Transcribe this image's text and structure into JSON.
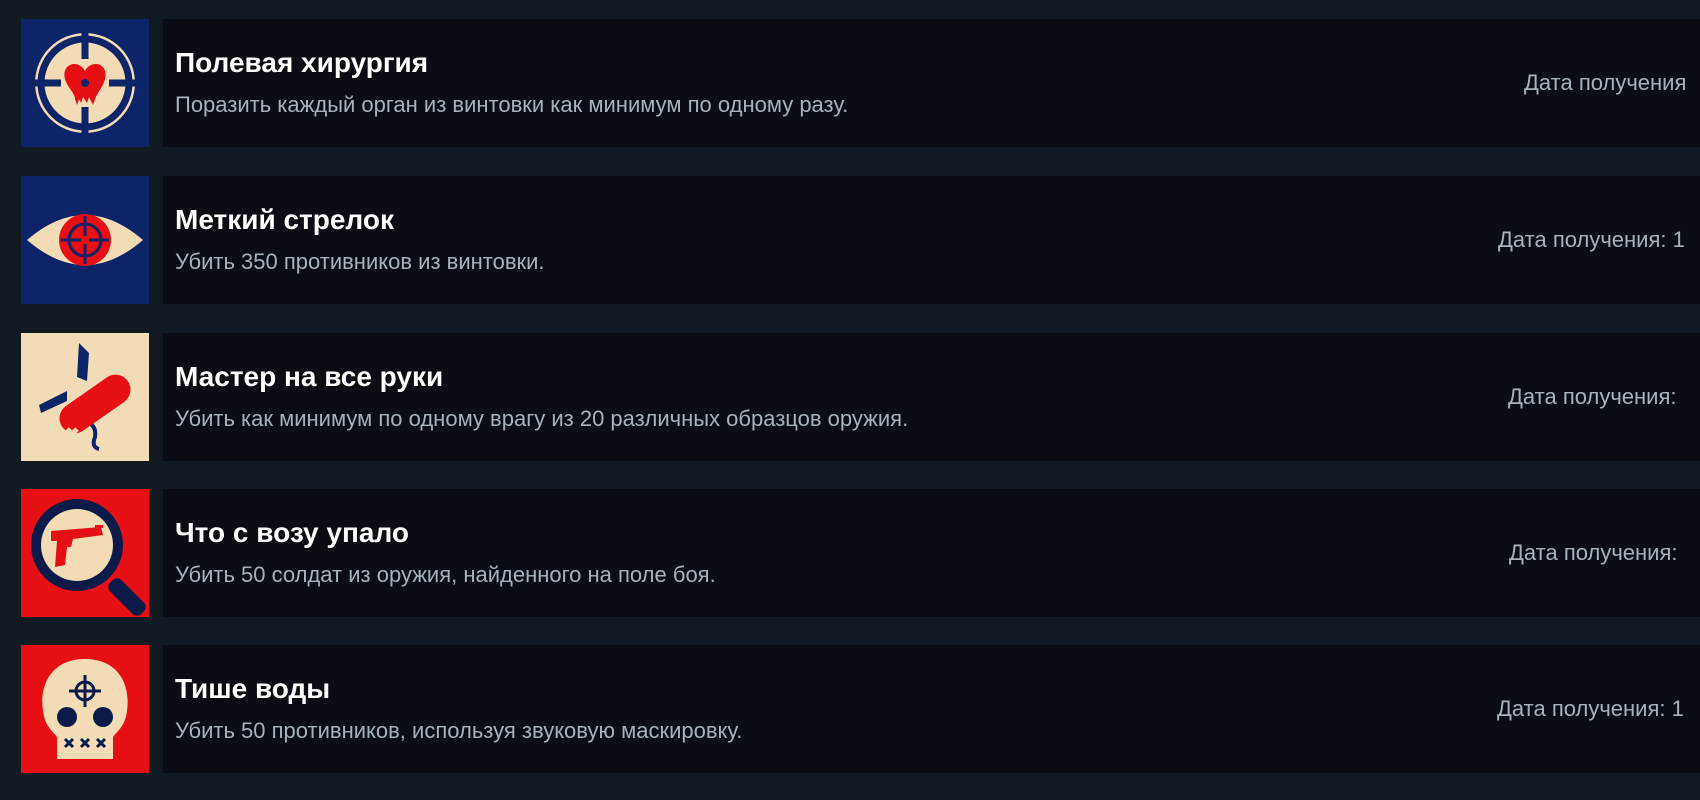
{
  "colors": {
    "page_bg": "#111a23",
    "panel_bg": "#0a0e14",
    "title": "#ffffff",
    "desc": "#a7b2bc",
    "icon_navy": "#0d2468",
    "icon_red": "#e50f14",
    "icon_cream": "#f1dcb6",
    "icon_dark_navy": "#0c1a4a"
  },
  "achievements": [
    {
      "icon": "crosshair-heart-icon",
      "title": "Полевая хирургия",
      "description": "Поразить каждый орган из винтовки как минимум по одному разу.",
      "date_label": "Дата получения"
    },
    {
      "icon": "eye-crosshair-icon",
      "title": "Меткий стрелок",
      "description": "Убить 350 противников из винтовки.",
      "date_label": "Дата получения: 1"
    },
    {
      "icon": "multitool-knife-icon",
      "title": "Мастер на все руки",
      "description": "Убить как минимум по одному врагу из 20 различных образцов оружия.",
      "date_label": "Дата получения:"
    },
    {
      "icon": "magnifier-pistol-icon",
      "title": "Что с возу упало",
      "description": "Убить 50 солдат из оружия, найденного на поле боя.",
      "date_label": "Дата получения:"
    },
    {
      "icon": "skull-crosshair-icon",
      "title": "Тише воды",
      "description": "Убить 50 противников, используя звуковую маскировку.",
      "date_label": "Дата получения: 1"
    }
  ]
}
